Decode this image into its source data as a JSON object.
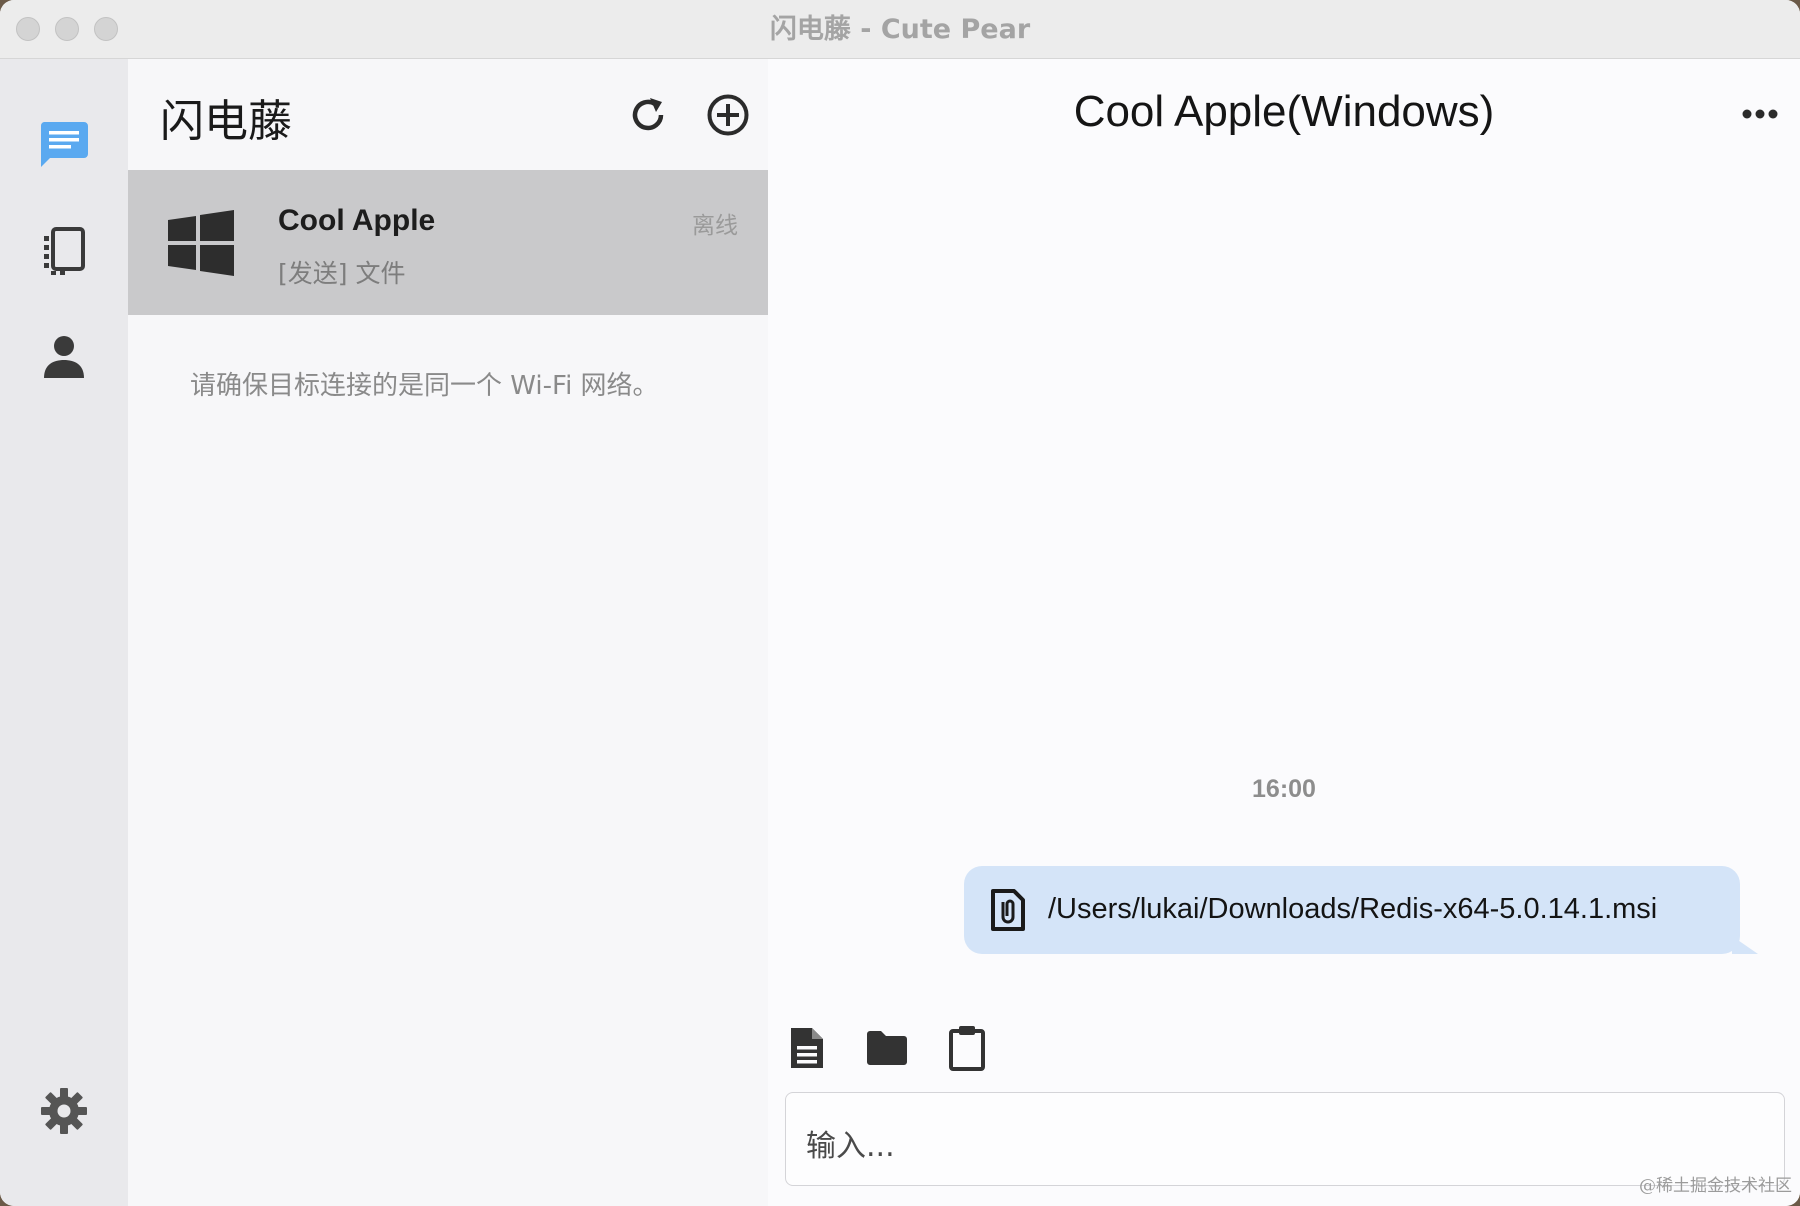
{
  "window": {
    "title": "闪电藤 - Cute Pear"
  },
  "colors": {
    "accent": "#5aa9f0",
    "selected_row": "#c9c9cb",
    "bubble": "#d4e4f8"
  },
  "nav": {
    "items": [
      {
        "name": "chat",
        "icon": "chat-bubble-icon",
        "active": true
      },
      {
        "name": "devices",
        "icon": "devices-icon",
        "active": false
      },
      {
        "name": "profile",
        "icon": "person-icon",
        "active": false
      },
      {
        "name": "settings",
        "icon": "gear-icon",
        "active": false
      }
    ]
  },
  "list": {
    "app_name": "闪电藤",
    "refresh_icon": "refresh-icon",
    "add_icon": "add-circle-icon",
    "devices": [
      {
        "name": "Cool Apple",
        "last_message": "[发送] 文件",
        "status": "离线",
        "os_icon": "windows-icon"
      }
    ],
    "hint": "请确保目标连接的是同一个 Wi-Fi 网络。"
  },
  "chat": {
    "title": "Cool Apple(Windows)",
    "more_icon": "more-horizontal-icon",
    "messages": [
      {
        "time": "16:00",
        "type": "file",
        "path": "/Users/lukai/Downloads/Redis-x64-5.0.14.1.msi"
      }
    ],
    "toolbar": [
      "file-icon",
      "folder-icon",
      "clipboard-icon"
    ],
    "input": {
      "placeholder": "输入..."
    }
  },
  "watermark": "@稀土掘金技术社区"
}
